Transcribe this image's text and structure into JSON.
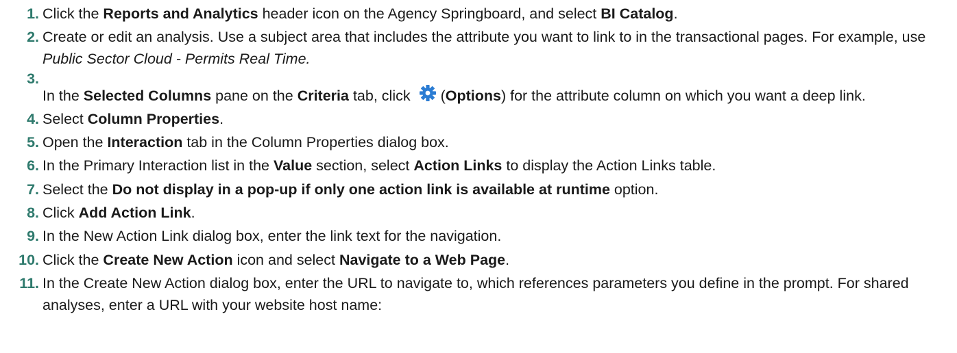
{
  "colors": {
    "number": "#2f7a6d",
    "text": "#1a1a1a",
    "gear_icon": "#2b7cd3"
  },
  "steps": [
    {
      "number": "1.",
      "parts": [
        "Click the ",
        "Reports and Analytics",
        " header icon on the Agency Springboard, and select ",
        "BI Catalog",
        "."
      ]
    },
    {
      "number": "2.",
      "parts": [
        "Create or edit an analysis. Use a subject area that includes the attribute you want to link to in the transactional pages. For example, use ",
        "Public Sector Cloud - Permits Real Time."
      ]
    },
    {
      "number": "3.",
      "parts": [
        "In the ",
        "Selected Columns",
        " pane on the ",
        "Criteria",
        " tab, click ",
        "(",
        "Options",
        ") for the attribute column on which you want a deep link."
      ],
      "icon": "gear-icon"
    },
    {
      "number": "4.",
      "parts": [
        "Select ",
        "Column Properties",
        "."
      ]
    },
    {
      "number": "5.",
      "parts": [
        "Open the ",
        "Interaction",
        " tab in the Column Properties dialog box."
      ]
    },
    {
      "number": "6.",
      "parts": [
        "In the Primary Interaction list in the ",
        "Value",
        " section, select ",
        "Action Links",
        " to display the Action Links table."
      ]
    },
    {
      "number": "7.",
      "parts": [
        "Select the ",
        "Do not display in a pop-up if only one action link is available at runtime",
        " option."
      ]
    },
    {
      "number": "8.",
      "parts": [
        "Click ",
        "Add Action Link",
        "."
      ]
    },
    {
      "number": "9.",
      "parts": [
        "In the New Action Link dialog box, enter the link text for the navigation."
      ]
    },
    {
      "number": "10.",
      "parts": [
        "Click the ",
        "Create New Action",
        " icon and select ",
        "Navigate to a Web Page",
        "."
      ]
    },
    {
      "number": "11.",
      "parts": [
        "In the Create New Action dialog box, enter the URL to navigate to, which references parameters you define in the prompt. For shared analyses, enter a URL with your website host name:"
      ]
    }
  ]
}
